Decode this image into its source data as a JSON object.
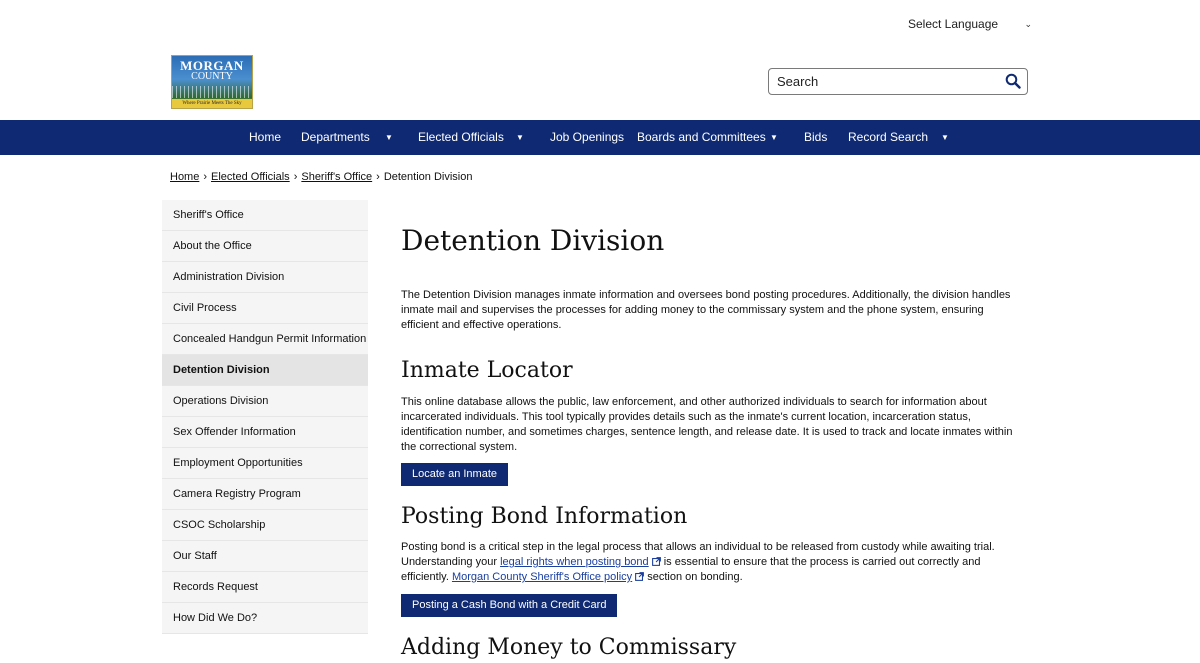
{
  "header": {
    "language_label": "Select Language",
    "search_placeholder": "Search",
    "logo": {
      "line1": "MORGAN",
      "line2": "COUNTY",
      "tagline": "Where Prairie Meets The Sky"
    }
  },
  "nav": {
    "items": [
      "Home",
      "Departments",
      "Elected Officials",
      "Job Openings",
      "Boards and Committees",
      "Bids",
      "Record Search"
    ]
  },
  "breadcrumb": {
    "items": [
      "Home",
      "Elected Officials",
      "Sheriff's Office"
    ],
    "current": "Detention Division",
    "separator": "›"
  },
  "sidebar": {
    "items": [
      "Sheriff's Office",
      "About the Office",
      "Administration Division",
      "Civil Process",
      "Concealed Handgun Permit Information",
      "Detention Division",
      "Operations Division",
      "Sex Offender Information",
      "Employment Opportunities",
      "Camera Registry Program",
      "CSOC Scholarship",
      "Our Staff",
      "Records Request",
      "How Did We Do?"
    ],
    "active_index": 5
  },
  "main": {
    "title": "Detention Division",
    "intro": "The Detention Division manages inmate information and oversees bond posting procedures. Additionally, the division handles inmate mail and supervises the processes for adding money to the commissary system and the phone system, ensuring efficient and effective operations.",
    "inmate_locator": {
      "heading": "Inmate Locator",
      "body": "This online database allows the public, law enforcement, and other authorized individuals to search for information about incarcerated individuals. This tool typically provides details such as the inmate's current location, incarceration status, identification number, and sometimes charges, sentence length, and release date. It is used to track and locate inmates within the correctional system.",
      "button": "Locate an Inmate"
    },
    "posting_bond": {
      "heading": "Posting Bond Information",
      "body_start": "Posting bond is a critical step in the legal process that allows an individual to be released from custody while awaiting trial. Understanding your ",
      "link1": "legal rights when posting bond",
      "body_mid": " is essential to ensure that the process is carried out correctly and efficiently. ",
      "link2": "Morgan County Sheriff's Office policy",
      "body_end": " section on bonding.",
      "button": "Posting a Cash Bond with a Credit Card"
    },
    "next_heading": "Adding Money to Commissary"
  },
  "colors": {
    "nav_bg": "#0f2a72",
    "button_bg": "#0f2a72",
    "link": "#1a3fa0"
  }
}
